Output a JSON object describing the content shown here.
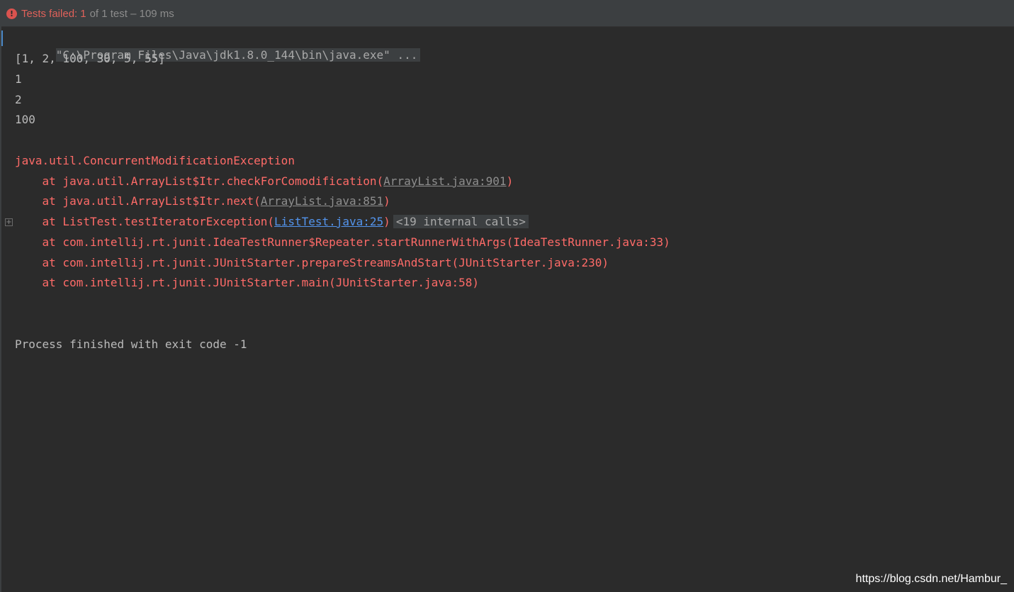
{
  "status": {
    "label": "Tests failed:",
    "failed_count": "1",
    "rest": "of 1 test – 109 ms",
    "icon": "error-icon",
    "color": "#e0615a"
  },
  "console": {
    "command": "\"C:\\Program Files\\Java\\jdk1.8.0_144\\bin\\java.exe\" ...",
    "outputs": [
      "[1, 2, 100, 30, 5, 55]",
      "1",
      "2",
      "100"
    ],
    "exception": "java.util.ConcurrentModificationException",
    "trace": {
      "t1_prefix": "    at java.util.ArrayList$Itr.checkForComodification(",
      "t1_link": "ArrayList.java:901",
      "t1_suffix": ")",
      "t2_prefix": "    at java.util.ArrayList$Itr.next(",
      "t2_link": "ArrayList.java:851",
      "t2_suffix": ")",
      "t3_prefix": "    at ListTest.testIteratorException(",
      "t3_link": "ListTest.java:25",
      "t3_suffix": ")",
      "t3_internal": "<19 internal calls>",
      "t4": "    at com.intellij.rt.junit.IdeaTestRunner$Repeater.startRunnerWithArgs(IdeaTestRunner.java:33)",
      "t5": "    at com.intellij.rt.junit.JUnitStarter.prepareStreamsAndStart(JUnitStarter.java:230)",
      "t6": "    at com.intellij.rt.junit.JUnitStarter.main(JUnitStarter.java:58)"
    },
    "exit_message": "Process finished with exit code -1"
  },
  "watermark": "https://blog.csdn.net/Hambur_",
  "colors": {
    "background": "#2b2b2b",
    "error_text": "#ff6b68",
    "link": "#5394ec",
    "normal_text": "#bbbbbb"
  }
}
